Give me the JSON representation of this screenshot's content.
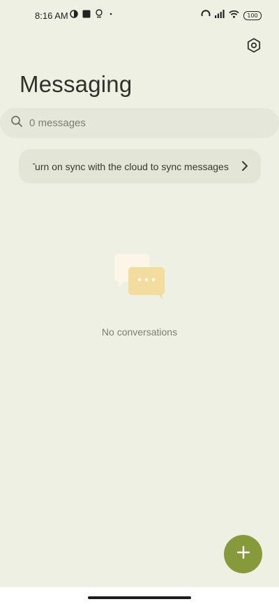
{
  "status_bar": {
    "time": "8:16 AM",
    "battery": "100",
    "left_icons": [
      "pie-chart-icon",
      "square-notification-icon",
      "location-pin-icon",
      "dot-icon"
    ],
    "right_icons": [
      "alarm-icon",
      "signal-icon",
      "wifi-icon",
      "battery-icon"
    ]
  },
  "header": {
    "title": "Messaging",
    "settings_icon": "settings-icon"
  },
  "search": {
    "placeholder": "0 messages",
    "icon": "search-icon"
  },
  "sync_banner": {
    "text": "Turn on sync with the cloud to sync messages",
    "icon": "chevron-right-icon"
  },
  "empty_state": {
    "message": "No conversations",
    "icon": "chat-bubbles-icon"
  },
  "fab": {
    "icon": "plus-icon",
    "color": "#86993b"
  },
  "colors": {
    "background": "#eef0e3",
    "surface": "#e3e5d7",
    "accent": "#86993b"
  }
}
